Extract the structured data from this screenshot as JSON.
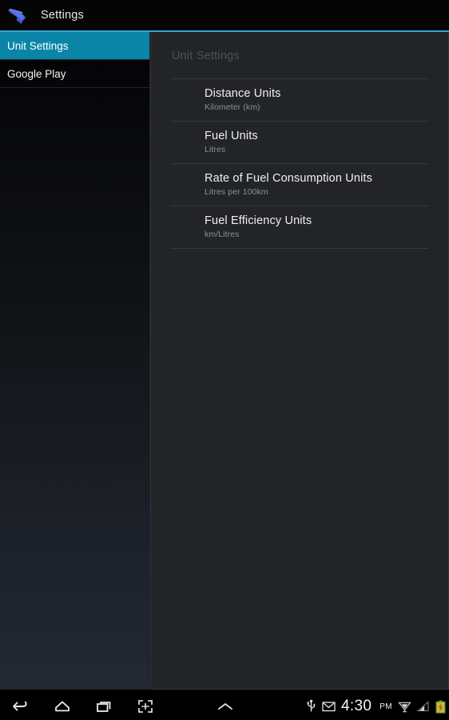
{
  "actionbar": {
    "icon": "fuel-nozzle-icon",
    "title": "Settings"
  },
  "accent_color": "#31a6d8",
  "sidebar": {
    "items": [
      {
        "label": "Unit Settings",
        "selected": true
      },
      {
        "label": "Google Play",
        "selected": false
      }
    ],
    "selected_color": "#0a85a8"
  },
  "panel": {
    "header": "Unit Settings",
    "rows": [
      {
        "title": "Distance Units",
        "subtitle": "Kilometer (km)"
      },
      {
        "title": "Fuel Units",
        "subtitle": "Litres"
      },
      {
        "title": "Rate of Fuel Consumption Units",
        "subtitle": "Litres per 100km"
      },
      {
        "title": "Fuel Efficiency Units",
        "subtitle": "km/Litres"
      }
    ]
  },
  "navbar": {
    "buttons": [
      {
        "name": "back-icon",
        "label": "Back"
      },
      {
        "name": "home-icon",
        "label": "Home"
      },
      {
        "name": "recents-icon",
        "label": "Recent apps"
      },
      {
        "name": "screenshot-icon",
        "label": "Screenshot"
      }
    ],
    "chevron": {
      "name": "chevron-up-icon",
      "label": "Expand"
    },
    "status": {
      "usb_icon": "usb-icon",
      "mail_icon": "gmail-envelope-icon",
      "time": "4:30",
      "meridiem": "PM",
      "wifi_icon": "wifi-icon",
      "signal_icon": "cell-signal-icon",
      "battery_icon": "battery-charging-icon"
    }
  }
}
